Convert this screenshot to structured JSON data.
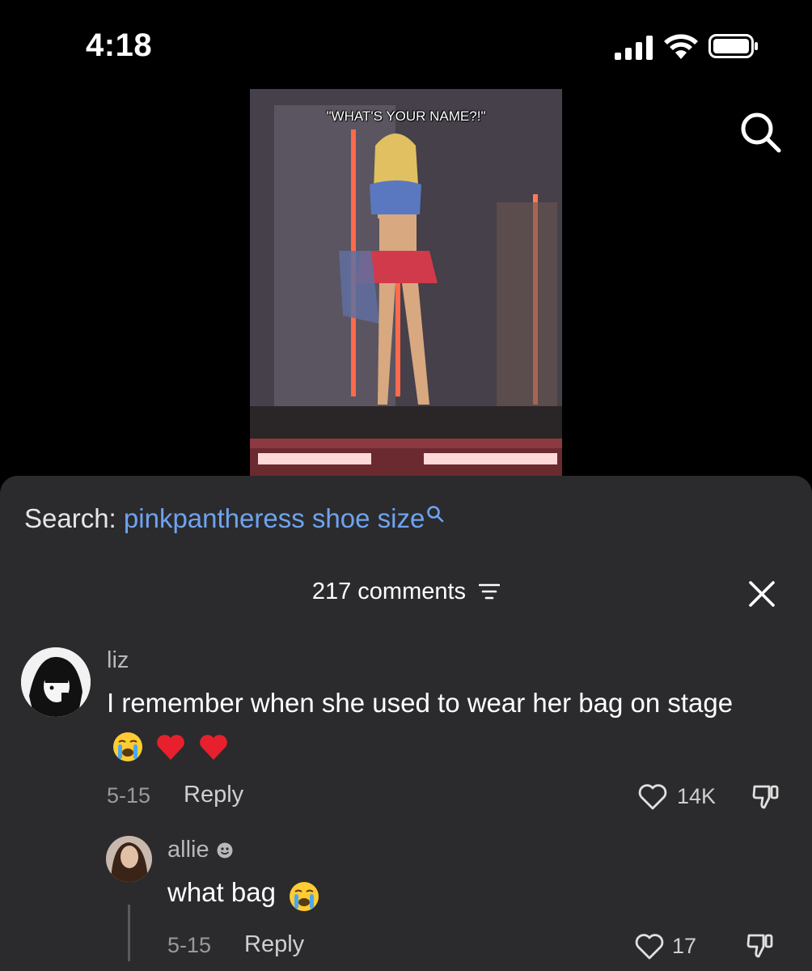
{
  "status_bar": {
    "time": "4:18",
    "icons": [
      "signal-icon",
      "wifi-icon",
      "battery-icon"
    ]
  },
  "video": {
    "caption": "\"WHAT'S YOUR NAME?!\"",
    "search_icon": "search-icon"
  },
  "search_suggestion": {
    "prefix": "Search:",
    "query": "pinkpantheress shoe size",
    "icon": "search-icon"
  },
  "comments_header": {
    "count_label": "217 comments",
    "filter_icon": "filter-icon",
    "close_icon": "close-icon"
  },
  "comments": [
    {
      "username": "liz",
      "text": "I remember when she used to wear her bag on stage",
      "emojis": [
        "crying-face-emoji",
        "red-heart-emoji",
        "red-heart-emoji"
      ],
      "date": "5-15",
      "reply_label": "Reply",
      "likes": "14K"
    },
    {
      "username": "allie",
      "username_badge": "smiley-icon",
      "text": "what bag",
      "emojis": [
        "crying-face-emoji"
      ],
      "date": "5-15",
      "reply_label": "Reply",
      "likes": "17"
    }
  ],
  "colors": {
    "background": "#000000",
    "sheet": "#2b2b2d",
    "search_query": "#6fa3f0",
    "secondary_text": "#9a9a9a"
  }
}
